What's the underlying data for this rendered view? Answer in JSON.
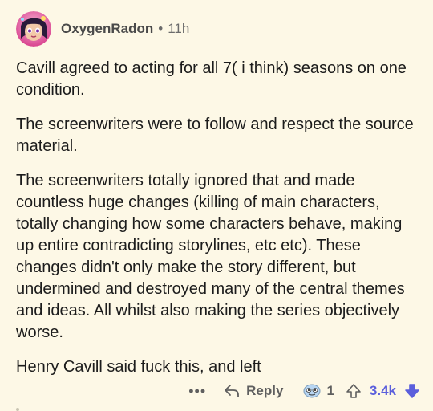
{
  "comment": {
    "username": "OxygenRadon",
    "separator": "•",
    "age": "11h",
    "paragraphs": [
      "Cavill agreed to acting for all 7( i think) seasons on one condition.",
      "The screenwriters were to follow and respect the source material.",
      "The screenwriters totally ignored that and made countless huge changes (killing of main characters, totally changing how some characters behave, making up entire contradicting storylines, etc etc). These changes didn't only make the story different, but undermined and destroyed many of the central themes and ideas. All whilst also making the series objectively worse.",
      "Henry Cavill said fuck this, and left"
    ]
  },
  "actions": {
    "more_label": "•••",
    "reply_label": "Reply",
    "award_count": "1",
    "score": "3.4k"
  },
  "colors": {
    "background": "#fdf8e6",
    "score_accent": "#5b5fdc",
    "downvote_active": "#6a5cff"
  },
  "icons": {
    "avatar": "avatar-image",
    "reply": "reply-arrow-icon",
    "award": "award-icon",
    "upvote": "upvote-arrow-icon",
    "downvote": "downvote-arrow-icon"
  }
}
